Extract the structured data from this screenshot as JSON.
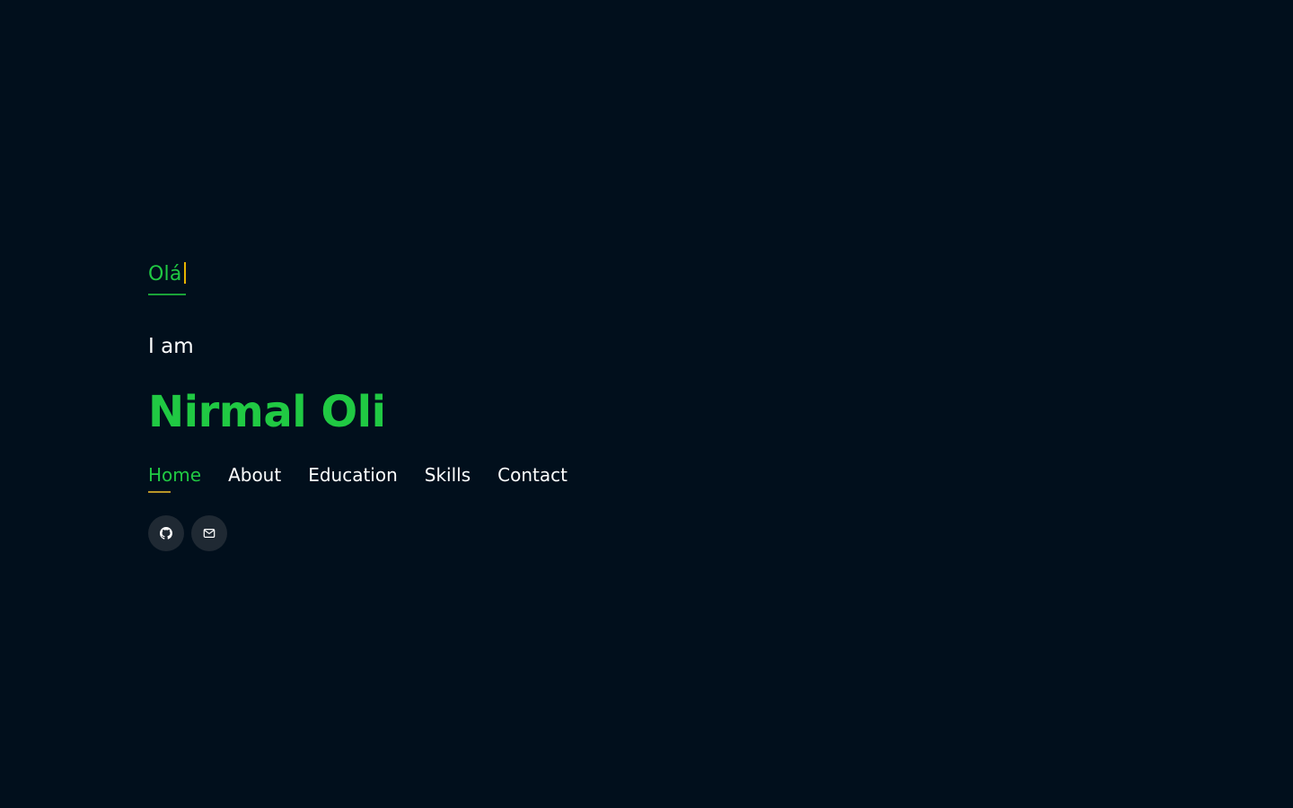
{
  "hero": {
    "greeting": "Olá",
    "intro": "I am",
    "name": "Nirmal Oli"
  },
  "nav": {
    "items": [
      {
        "label": "Home",
        "active": true
      },
      {
        "label": "About",
        "active": false
      },
      {
        "label": "Education",
        "active": false
      },
      {
        "label": "Skills",
        "active": false
      },
      {
        "label": "Contact",
        "active": false
      }
    ]
  },
  "socials": [
    {
      "icon": "github-icon"
    },
    {
      "icon": "mail-icon"
    }
  ],
  "colors": {
    "background": "#010f1c",
    "accent": "#20c943",
    "underline": "#b89628",
    "cursor": "#e6b400",
    "icon_bg": "#1f2933"
  }
}
